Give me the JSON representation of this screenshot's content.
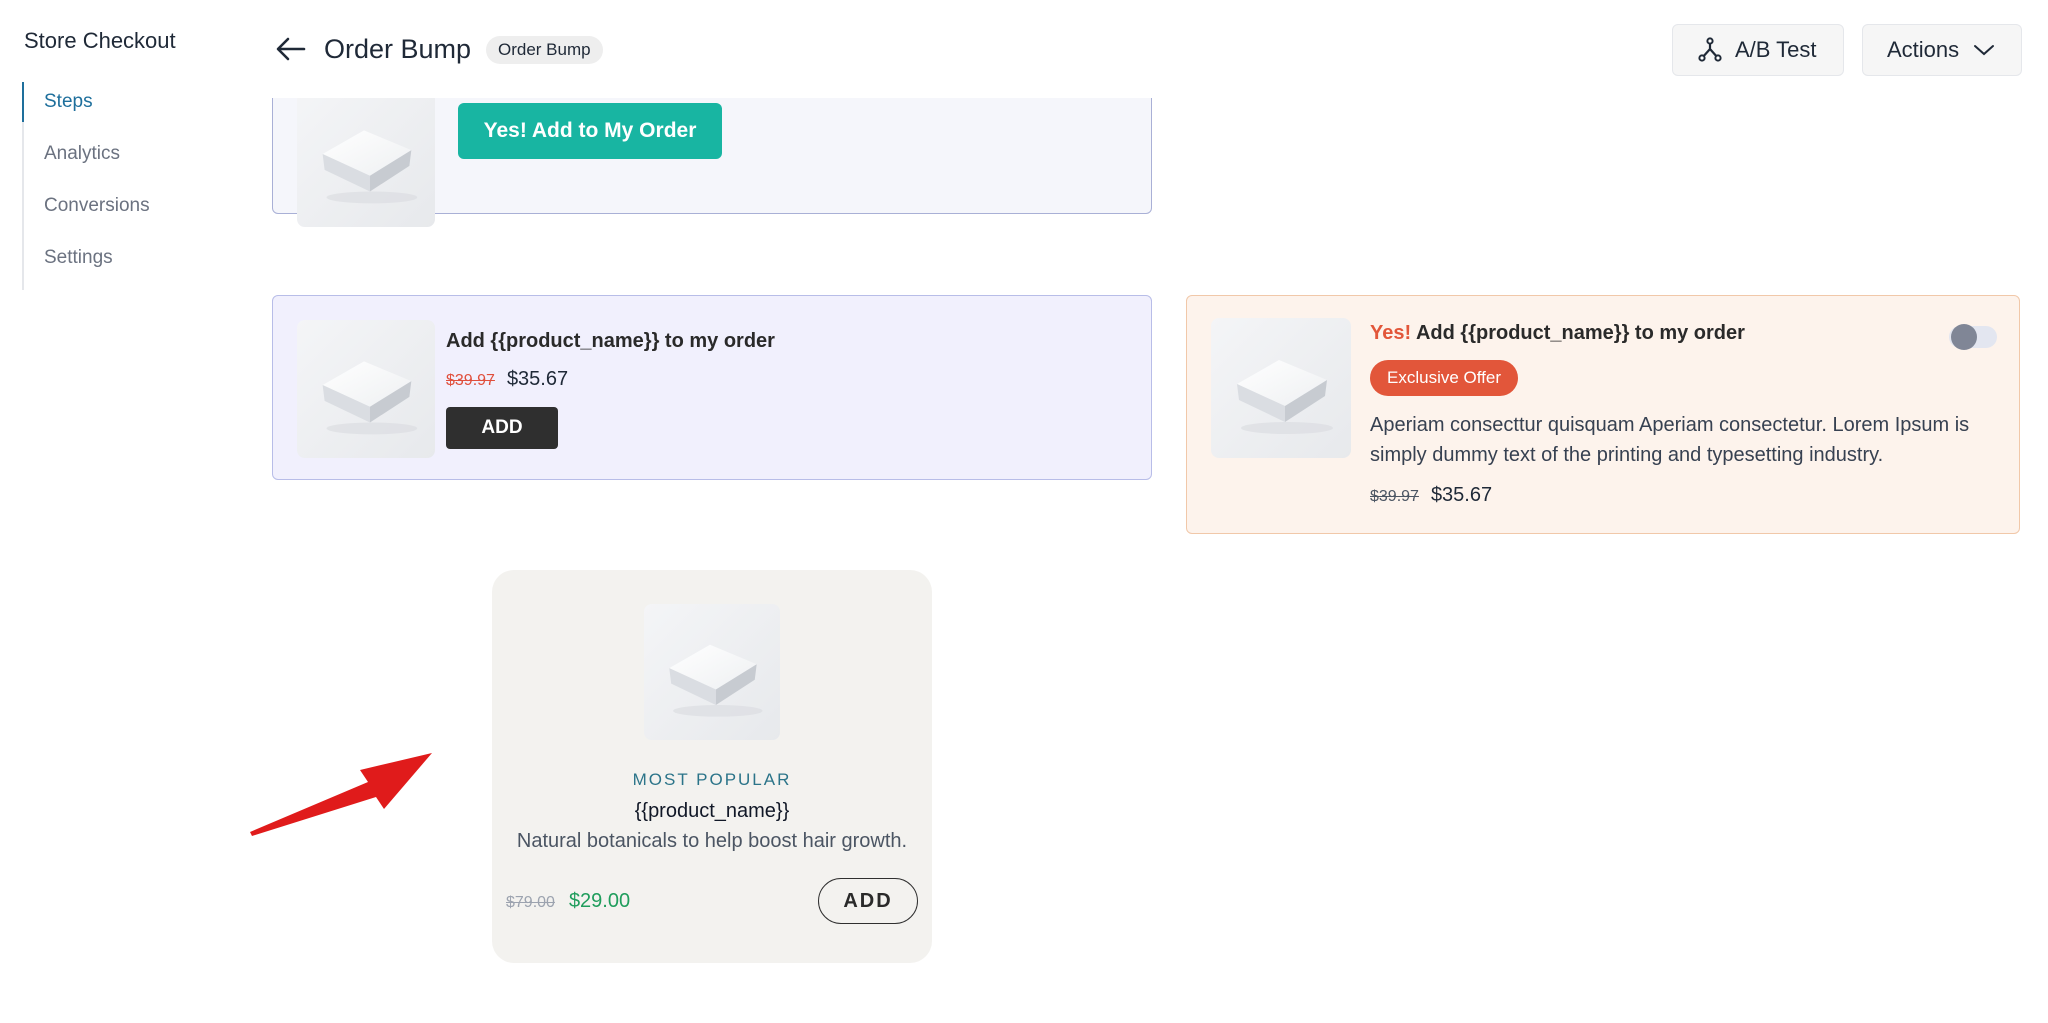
{
  "sidebar": {
    "title": "Store Checkout",
    "items": [
      {
        "label": "Steps",
        "active": true
      },
      {
        "label": "Analytics"
      },
      {
        "label": "Conversions"
      },
      {
        "label": "Settings"
      }
    ]
  },
  "header": {
    "title": "Order Bump",
    "badge": "Order Bump",
    "ab_test_label": "A/B Test",
    "actions_label": "Actions"
  },
  "card1": {
    "button_label": "Yes! Add to My Order"
  },
  "card2": {
    "title": "Add {{product_name}} to my order",
    "old_price": "$39.97",
    "new_price": "$35.67",
    "button_label": "ADD"
  },
  "card3": {
    "yes_text": "Yes!",
    "title": "Add {{product_name}} to my order",
    "badge": "Exclusive Offer",
    "description": "Aperiam consecttur quisquam Aperiam consectetur. Lorem Ipsum is simply dummy text of the printing and typesetting industry.",
    "old_price": "$39.97",
    "new_price": "$35.67",
    "toggle_on": false
  },
  "card4": {
    "label": "MOST POPULAR",
    "name": "{{product_name}}",
    "description": "Natural botanicals to help boost hair growth.",
    "old_price": "$79.00",
    "new_price": "$29.00",
    "button_label": "ADD"
  },
  "colors": {
    "accent_teal": "#18b5a2",
    "nav_active": "#1e6f9c",
    "badge_orange": "#e2563a",
    "price_green": "#1f9d5c",
    "annotation_red": "#e01b1b"
  }
}
